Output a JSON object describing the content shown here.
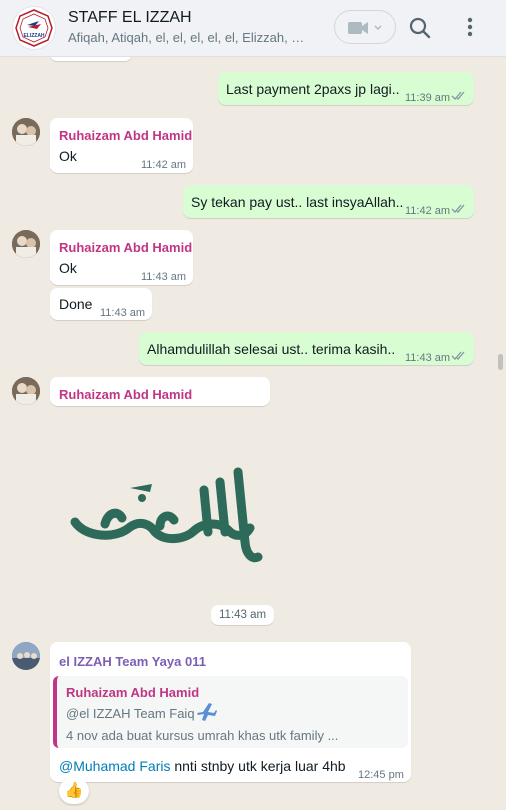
{
  "header": {
    "title": "STAFF EL IZZAH",
    "subtitle": "Afiqah, Atiqah, el, el, el, el, el, Elizzah, F...",
    "logo_text": "ELIZZAH",
    "icons": [
      "video-icon",
      "chevron-down-icon",
      "search-icon",
      "menu-icon"
    ]
  },
  "messages": [
    {
      "text": "Last payment 2paxs jp lagi..",
      "time": "11:39 am"
    },
    {
      "sender": "Ruhaizam Abd Hamid",
      "text": "Ok",
      "time": "11:42 am"
    },
    {
      "text": "Sy tekan pay ust.. last insyaAllah..",
      "time": "11:42 am"
    },
    {
      "sender": "Ruhaizam Abd Hamid",
      "text": "Ok",
      "time": "11:43 am"
    },
    {
      "text": "Done",
      "time": "11:43 am"
    },
    {
      "text": "Alhamdulillah  selesai ust.. terima kasih..",
      "time": "11:43 am"
    },
    {
      "sender": "Ruhaizam Abd Hamid",
      "sticker": "alhamdulillah-calligraphy",
      "time": "11:43 am"
    },
    {
      "sender": "el IZZAH Team Yaya 011",
      "quote": {
        "sender": "Ruhaizam Abd Hamid",
        "line1": "@el IZZAH Team Faiq",
        "line2": "4 nov ada buat kursus umrah khas utk family ..."
      },
      "mention": "@Muhamad Faris",
      "text": " nnti stnby utk kerja luar 4hb",
      "time": "12:45 pm",
      "reaction": "👍"
    }
  ],
  "colors": {
    "chat_bg": "#efeae2",
    "outgoing": "#d9fdd3",
    "incoming": "#ffffff",
    "sender_ruhaizam": "#c13584",
    "sender_yaya": "#7b5fb5",
    "mention": "#027eb5",
    "ticks": "#8696a0"
  }
}
